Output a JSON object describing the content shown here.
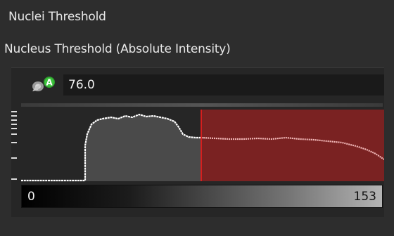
{
  "panel": {
    "title": "Nuclei Threshold",
    "subtitle": "Nucleus Threshold (Absolute Intensity)"
  },
  "threshold": {
    "value_text": "76.0",
    "auto_icon": "auto-threshold-icon"
  },
  "histogram": {
    "range_min_label": "0",
    "range_max_label": "153",
    "threshold": 76,
    "max": 153,
    "colors": {
      "fill": "#4a4a4a",
      "line_below": "#ffffff",
      "line_above": "#f2b9b9",
      "threshold_region": "#7a2222",
      "threshold_line": "#d81e1e"
    }
  }
}
